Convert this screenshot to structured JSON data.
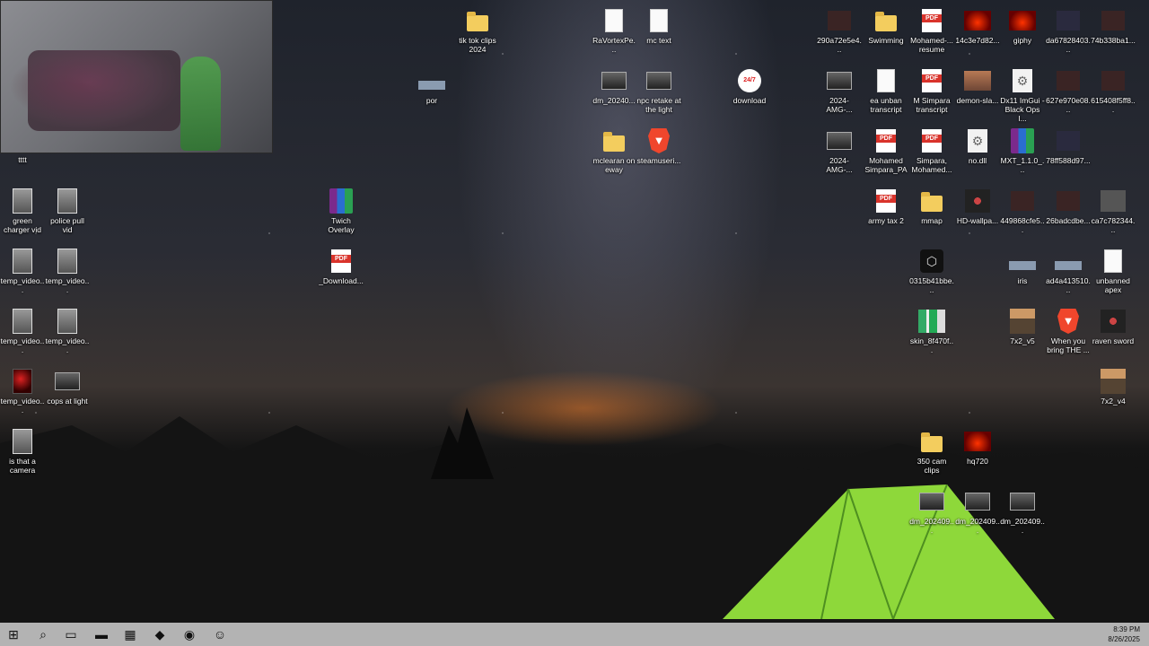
{
  "desktop": {
    "webcam_label": "tttt",
    "icons": [
      {
        "label": "tik tok clips 2024",
        "type": "folder"
      },
      {
        "label": "RaVortexPe...",
        "type": "doc"
      },
      {
        "label": "mc text",
        "type": "doc"
      },
      {
        "label": "por",
        "type": "bar"
      },
      {
        "label": "dm_20240...",
        "type": "vidwide"
      },
      {
        "label": "npc retake at the light",
        "type": "vidwide"
      },
      {
        "label": "download",
        "type": "circle",
        "glyph": "24/7"
      },
      {
        "label": "mclearan on eway",
        "type": "folder"
      },
      {
        "label": "steamuseri...",
        "type": "brave"
      },
      {
        "label": "green charger vid",
        "type": "vid"
      },
      {
        "label": "police pull vid",
        "type": "vid"
      },
      {
        "label": "Twich Overlay",
        "type": "rar"
      },
      {
        "label": "temp_video...",
        "type": "vid"
      },
      {
        "label": "temp_video...",
        "type": "vid"
      },
      {
        "label": "_Download...",
        "type": "pdf"
      },
      {
        "label": "temp_video...",
        "type": "vid"
      },
      {
        "label": "temp_video...",
        "type": "vid"
      },
      {
        "label": "temp_video...",
        "type": "vidred"
      },
      {
        "label": "cops at light",
        "type": "vidwide"
      },
      {
        "label": "is that a camera",
        "type": "vid"
      },
      {
        "label": "290a72e5e4...",
        "type": "dark"
      },
      {
        "label": "Swimming",
        "type": "folder"
      },
      {
        "label": "Mohamed-... resume",
        "type": "pdf"
      },
      {
        "label": "14c3e7d82...",
        "type": "fire"
      },
      {
        "label": "giphy",
        "type": "fire"
      },
      {
        "label": "da67828403...",
        "type": "darkblue"
      },
      {
        "label": "74b338ba1...",
        "type": "dark"
      },
      {
        "label": "2024-AMG-...",
        "type": "vidwide"
      },
      {
        "label": "ea unban transcript",
        "type": "doc"
      },
      {
        "label": "M Simpara transcript",
        "type": "pdf"
      },
      {
        "label": "demon-sla...",
        "type": "hazy"
      },
      {
        "label": "Dx11 ImGui - Black Ops I...",
        "type": "gear"
      },
      {
        "label": "627e970e08...",
        "type": "dark"
      },
      {
        "label": "615408f5ff8...",
        "type": "dark"
      },
      {
        "label": "2024-AMG-...",
        "type": "vidwide"
      },
      {
        "label": "Mohamed Simpara_PA",
        "type": "pdf"
      },
      {
        "label": "Simpara, Mohamed...",
        "type": "pdf"
      },
      {
        "label": "no.dll",
        "type": "gear"
      },
      {
        "label": "MXT_1.1.0_...",
        "type": "rar"
      },
      {
        "label": "78ff588d97...",
        "type": "darkblue"
      },
      {
        "label": "army tax 2",
        "type": "pdf"
      },
      {
        "label": "mmap",
        "type": "folder"
      },
      {
        "label": "HD-wallpa...",
        "type": "face"
      },
      {
        "label": "449868cfe5...",
        "type": "dark"
      },
      {
        "label": "26badcdbe...",
        "type": "dark"
      },
      {
        "label": "ca7c782344...",
        "type": "gray"
      },
      {
        "label": "0315b41bbe...",
        "type": "hex"
      },
      {
        "label": "iris",
        "type": "bar"
      },
      {
        "label": "ad4a413510...",
        "type": "bar"
      },
      {
        "label": "unbanned apex",
        "type": "doc"
      },
      {
        "label": "skin_8f470f...",
        "type": "skin"
      },
      {
        "label": "7x2_v5",
        "type": "char"
      },
      {
        "label": "When you bring THE ...",
        "type": "brave"
      },
      {
        "label": "raven sword",
        "type": "face"
      },
      {
        "label": "7x2_v4",
        "type": "char"
      },
      {
        "label": "350 cam clips",
        "type": "folder"
      },
      {
        "label": "hq720",
        "type": "fire"
      },
      {
        "label": "dm_202409...",
        "type": "vidwide"
      },
      {
        "label": "dm_202409...",
        "type": "vidwide"
      },
      {
        "label": "dm_202409...",
        "type": "vidwide"
      }
    ]
  },
  "taskbar": {
    "items": [
      {
        "name": "start-button",
        "glyph": "⊞"
      },
      {
        "name": "search-button",
        "glyph": "⌕"
      },
      {
        "name": "task-view-button",
        "glyph": "▭"
      },
      {
        "name": "file-explorer-button",
        "glyph": "▬"
      },
      {
        "name": "store-button",
        "glyph": "▦"
      },
      {
        "name": "brave-button",
        "glyph": "◆"
      },
      {
        "name": "obs-button",
        "glyph": "◉"
      },
      {
        "name": "discord-button",
        "glyph": "☺"
      }
    ],
    "time": "8:39 PM",
    "date": "8/26/2025"
  }
}
